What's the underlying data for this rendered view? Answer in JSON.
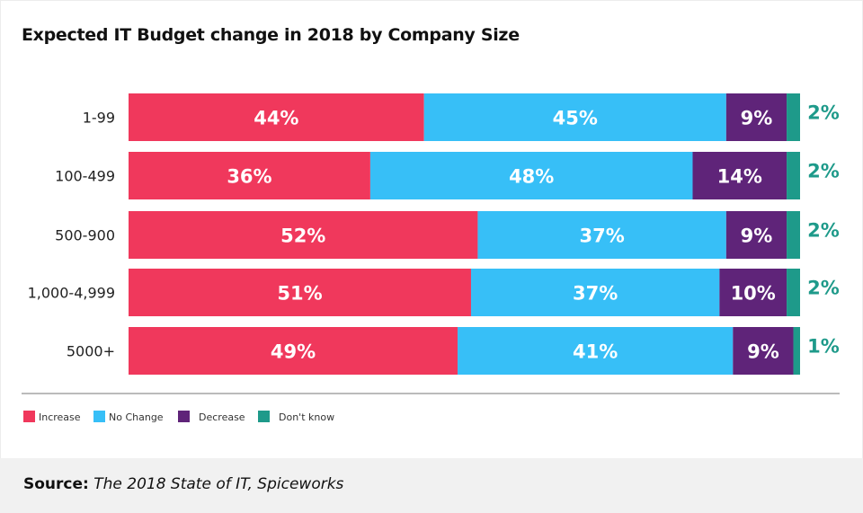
{
  "chart_data": {
    "type": "bar",
    "orientation": "horizontal-stacked",
    "title": "Expected IT Budget change in 2018 by Company Size",
    "categories": [
      "1-99",
      "100-499",
      "500-900",
      "1,000-4,999",
      "5000+"
    ],
    "series": [
      {
        "name": "Increase",
        "color": "#f0385c",
        "values": [
          44,
          36,
          52,
          51,
          49
        ]
      },
      {
        "name": "No Change",
        "color": "#37bff7",
        "values": [
          45,
          48,
          37,
          37,
          41
        ]
      },
      {
        "name": "Decrease",
        "color": "#5f2479",
        "values": [
          9,
          14,
          9,
          10,
          9
        ]
      },
      {
        "name": "Don't know",
        "color": "#1e9a8a",
        "values": [
          2,
          2,
          2,
          2,
          1
        ]
      }
    ],
    "value_suffix": "%",
    "xlim": [
      0,
      100
    ],
    "legend": "bottom-left",
    "grid": false
  },
  "footer": {
    "source_label": "Source:",
    "source_text": "The 2018 State of IT, Spiceworks"
  }
}
